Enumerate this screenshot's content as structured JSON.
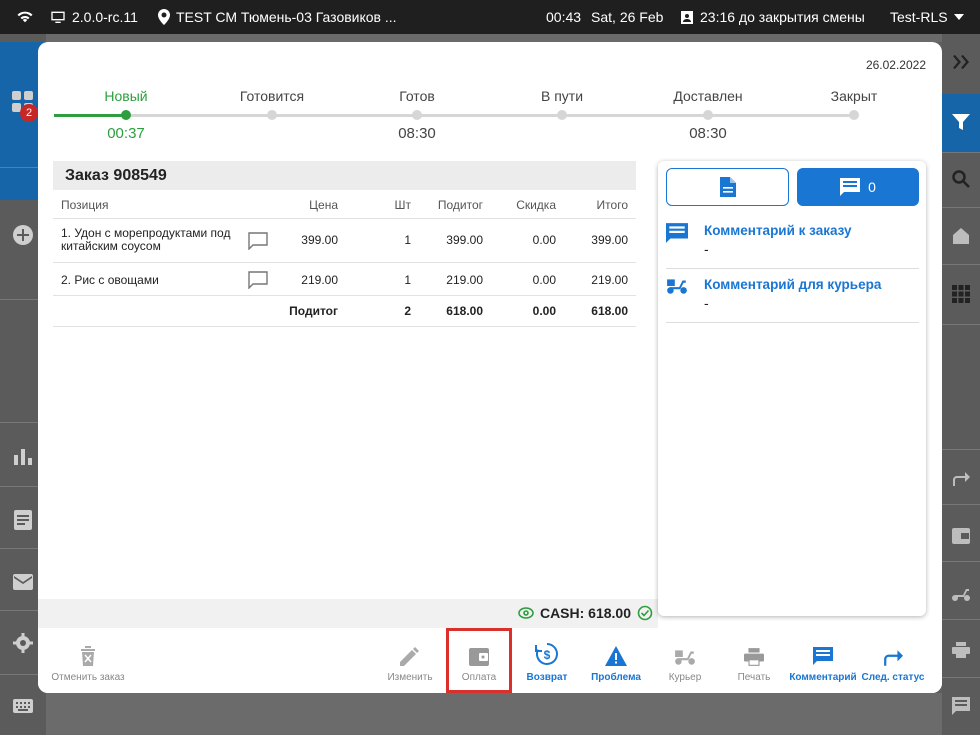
{
  "statusbar": {
    "version": "2.0.0-rc.11",
    "location": "TEST СМ Тюмень-03 Газовиков ...",
    "clock_time": "00:43",
    "clock_date": "Sat, 26 Feb",
    "shift_info": "23:16 до закрытия смены",
    "user": "Test-RLS"
  },
  "left_rail": {
    "badge_count": "2"
  },
  "modal": {
    "date": "26.02.2022",
    "steps": [
      {
        "label": "Новый",
        "time": "00:37",
        "done": true
      },
      {
        "label": "Готовится",
        "time": ""
      },
      {
        "label": "Готов",
        "time": "08:30"
      },
      {
        "label": "В пути",
        "time": ""
      },
      {
        "label": "Доставлен",
        "time": "08:30"
      },
      {
        "label": "Закрыт",
        "time": ""
      }
    ],
    "order_title": "Заказ 908549",
    "table": {
      "headers": {
        "position": "Позиция",
        "price": "Цена",
        "qty": "Шт",
        "subtotal": "Подитог",
        "discount": "Скидка",
        "total": "Итого"
      },
      "rows": [
        {
          "name": "1. Удон с морепродуктами под китайским соусом",
          "price": "399.00",
          "qty": "1",
          "subtotal": "399.00",
          "discount": "0.00",
          "total": "399.00"
        },
        {
          "name": "2. Рис с овощами",
          "price": "219.00",
          "qty": "1",
          "subtotal": "219.00",
          "discount": "0.00",
          "total": "219.00"
        }
      ],
      "totals": {
        "label": "Подитог",
        "qty": "2",
        "subtotal": "618.00",
        "discount": "0.00",
        "total": "618.00"
      }
    },
    "payment": "CASH: 618.00",
    "side": {
      "comments_count": "0",
      "order_comment_title": "Комментарий к заказу",
      "order_comment_value": "-",
      "courier_comment_title": "Комментарий для курьера",
      "courier_comment_value": "-"
    },
    "toolbar": {
      "cancel": "Отменить заказ",
      "edit": "Изменить",
      "payment": "Оплата",
      "refund": "Возврат",
      "problem": "Проблема",
      "courier": "Курьер",
      "print": "Печать",
      "comment": "Комментарий",
      "next_status": "След. статус"
    }
  },
  "colors": {
    "accent": "#1976d2",
    "success": "#2e9e3e",
    "highlight": "#d9302c"
  }
}
